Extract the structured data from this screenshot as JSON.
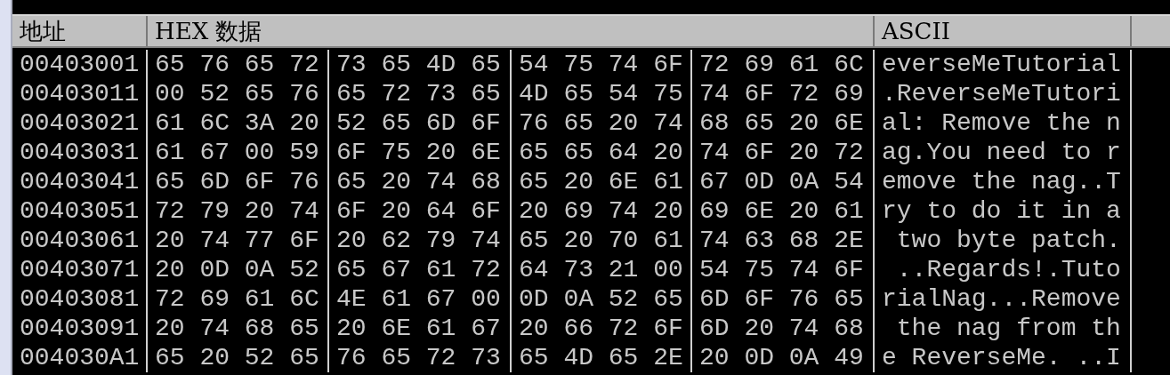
{
  "columns": [
    "地址",
    "HEX 数据",
    "ASCII"
  ],
  "rows": [
    {
      "address": "00403001",
      "hex": [
        "65 76 65 72",
        "73 65 4D 65",
        "54 75 74 6F",
        "72 69 61 6C"
      ],
      "ascii": "everseMeTutorial"
    },
    {
      "address": "00403011",
      "hex": [
        "00 52 65 76",
        "65 72 73 65",
        "4D 65 54 75",
        "74 6F 72 69"
      ],
      "ascii": ".ReverseMeTutori"
    },
    {
      "address": "00403021",
      "hex": [
        "61 6C 3A 20",
        "52 65 6D 6F",
        "76 65 20 74",
        "68 65 20 6E"
      ],
      "ascii": "al: Remove the n"
    },
    {
      "address": "00403031",
      "hex": [
        "61 67 00 59",
        "6F 75 20 6E",
        "65 65 64 20",
        "74 6F 20 72"
      ],
      "ascii": "ag.You need to r"
    },
    {
      "address": "00403041",
      "hex": [
        "65 6D 6F 76",
        "65 20 74 68",
        "65 20 6E 61",
        "67 0D 0A 54"
      ],
      "ascii": "emove the nag..T"
    },
    {
      "address": "00403051",
      "hex": [
        "72 79 20 74",
        "6F 20 64 6F",
        "20 69 74 20",
        "69 6E 20 61"
      ],
      "ascii": "ry to do it in a"
    },
    {
      "address": "00403061",
      "hex": [
        "20 74 77 6F",
        "20 62 79 74",
        "65 20 70 61",
        "74 63 68 2E"
      ],
      "ascii": " two byte patch."
    },
    {
      "address": "00403071",
      "hex": [
        "20 0D 0A 52",
        "65 67 61 72",
        "64 73 21 00",
        "54 75 74 6F"
      ],
      "ascii": " ..Regards!.Tuto"
    },
    {
      "address": "00403081",
      "hex": [
        "72 69 61 6C",
        "4E 61 67 00",
        "0D 0A 52 65",
        "6D 6F 76 65"
      ],
      "ascii": "rialNag...Remove"
    },
    {
      "address": "00403091",
      "hex": [
        "20 74 68 65",
        "20 6E 61 67",
        "20 66 72 6F",
        "6D 20 74 68"
      ],
      "ascii": " the nag from th"
    },
    {
      "address": "004030A1",
      "hex": [
        "65 20 52 65",
        "76 65 72 73",
        "65 4D 65 2E",
        "20 0D 0A 49"
      ],
      "ascii": "e ReverseMe. ..I"
    }
  ]
}
